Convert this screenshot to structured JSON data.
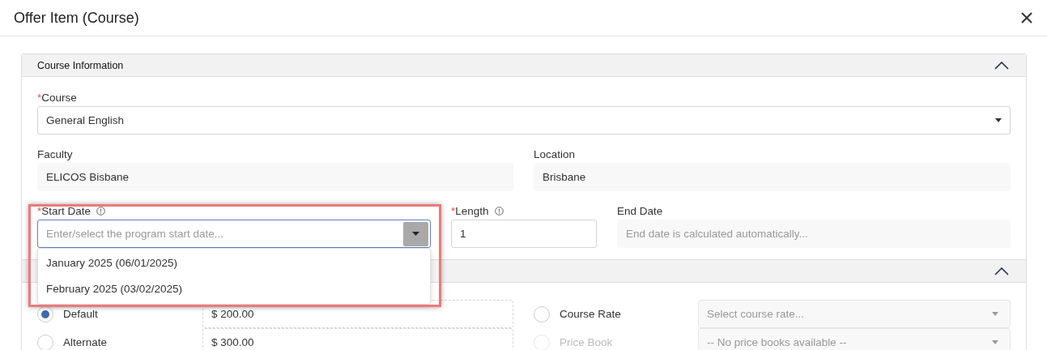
{
  "dialog": {
    "title": "Offer Item (Course)"
  },
  "course_information": {
    "title": "Course Information",
    "expanded": true,
    "course": {
      "label": "Course",
      "required_mark": "*",
      "value": "General English"
    },
    "faculty": {
      "label": "Faculty",
      "value": "ELICOS Bisbane"
    },
    "location": {
      "label": "Location",
      "value": "Brisbane"
    },
    "start_date": {
      "label": "Start Date",
      "required_mark": "*",
      "placeholder": "Enter/select the program start date...",
      "expanded": true,
      "options": [
        {
          "label": "January 2025 (06/01/2025)"
        },
        {
          "label": "February 2025 (03/02/2025)"
        }
      ]
    },
    "length": {
      "label": "Length",
      "required_mark": "*",
      "value": "1"
    },
    "end_date": {
      "label": "End Date",
      "placeholder": "End date is calculated automatically..."
    }
  },
  "pricing": {
    "expanded": true,
    "amounts": [
      {
        "label": "Default",
        "selected": true,
        "value": "$ 200.00"
      },
      {
        "label": "Alternate",
        "selected": false,
        "value": "$ 300.00"
      }
    ],
    "rates": [
      {
        "label": "Course Rate",
        "selected": false,
        "disabled": false,
        "placeholder": "Select course rate..."
      },
      {
        "label": "Price Book",
        "selected": false,
        "disabled": true,
        "placeholder": "-- No price books available --"
      }
    ]
  }
}
